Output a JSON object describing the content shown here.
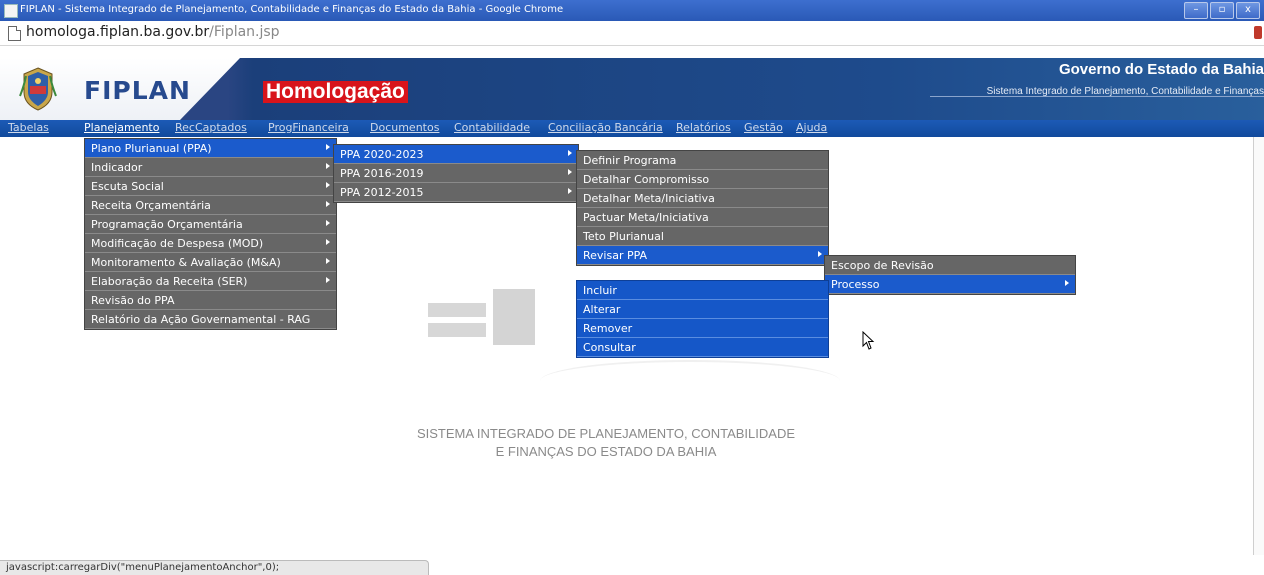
{
  "window": {
    "title": "FIPLAN - Sistema Integrado de Planejamento, Contabilidade e Finanças do Estado da Bahia - Google Chrome",
    "buttons": [
      "–",
      "▫",
      "x"
    ]
  },
  "address": {
    "domain": "homologa.fiplan.ba.gov.br",
    "path": "/Fiplan.jsp"
  },
  "header": {
    "logo_text": "FIPLAN",
    "env_badge": "Homologação",
    "gov_title": "Governo do Estado da Bahia",
    "gov_subtitle": "Sistema Integrado de Planejamento, Contabilidade e Finanças"
  },
  "menubar": {
    "items": [
      "Tabelas",
      "Planejamento",
      "RecCaptados",
      "ProgFinanceira",
      "Documentos",
      "Contabilidade",
      "Conciliação Bancária",
      "Relatórios",
      "Gestão",
      "Ajuda"
    ]
  },
  "menu_planejamento": {
    "items": [
      "Plano Plurianual (PPA)",
      "Indicador",
      "Escuta Social",
      "Receita Orçamentária",
      "Programação Orçamentária",
      "Modificação de Despesa (MOD)",
      "Monitoramento & Avaliação (M&A)",
      "Elaboração da Receita (SER)",
      "Revisão do PPA",
      "Relatório da Ação Governamental - RAG"
    ]
  },
  "menu_ppa": {
    "items": [
      "PPA 2020-2023",
      "PPA 2016-2019",
      "PPA 2012-2015"
    ]
  },
  "menu_ppa2020": {
    "items": [
      "Definir Programa",
      "Detalhar Compromisso",
      "Detalhar Meta/Iniciativa",
      "Pactuar Meta/Iniciativa",
      "Teto Plurianual",
      "Revisar PPA"
    ]
  },
  "menu_revisar": {
    "items": [
      "Escopo de Revisão",
      "Processo"
    ]
  },
  "menu_processo": {
    "items": [
      "Incluir",
      "Alterar",
      "Remover",
      "Consultar"
    ]
  },
  "watermark": {
    "line1": "SISTEMA INTEGRADO DE PLANEJAMENTO, CONTABILIDADE",
    "line2": "E FINANÇAS DO ESTADO DA BAHIA"
  },
  "status_text": "javascript:carregarDiv(\"menuPlanejamentoAnchor\",0);"
}
